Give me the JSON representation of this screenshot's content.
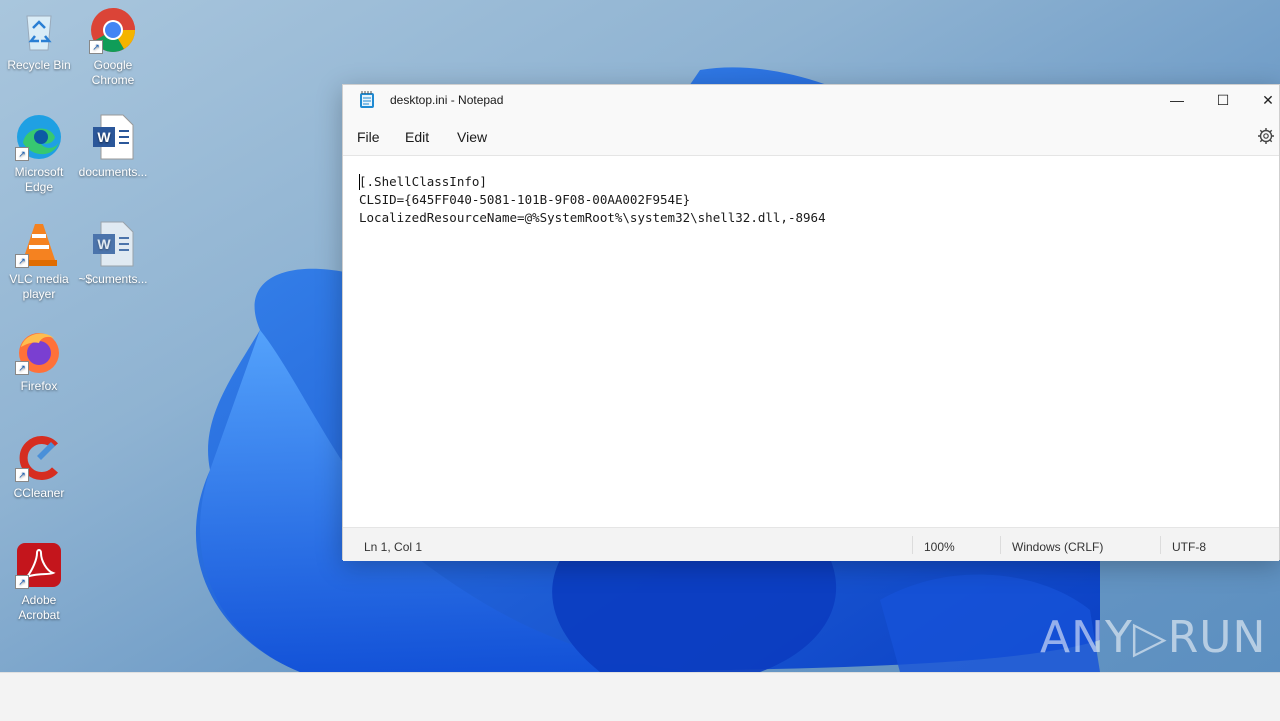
{
  "desktop": {
    "icons": [
      {
        "label": "Recycle Bin"
      },
      {
        "label": "Google Chrome"
      },
      {
        "label": "Microsoft Edge"
      },
      {
        "label": "documents..."
      },
      {
        "label": "VLC media player"
      },
      {
        "label": "~$cuments..."
      },
      {
        "label": "Firefox"
      },
      {
        "label": "CCleaner"
      },
      {
        "label": "Adobe Acrobat"
      }
    ]
  },
  "window": {
    "title": "desktop.ini - Notepad",
    "controls": {
      "minimize": "—",
      "maximize": "☐",
      "close": "✕"
    },
    "menu": [
      "File",
      "Edit",
      "View"
    ],
    "content": "[.ShellClassInfo]\nCLSID={645FF040-5081-101B-9F08-00AA002F954E}\nLocalizedResourceName=@%SystemRoot%\\system32\\shell32.dll,-8964",
    "status": {
      "position": "Ln 1, Col 1",
      "zoom": "100%",
      "line_ending": "Windows (CRLF)",
      "encoding": "UTF-8"
    }
  },
  "watermark": "ANY▷RUN",
  "colors": {
    "accent": "#0067c0",
    "wallpaper": "#1e5fd6"
  }
}
